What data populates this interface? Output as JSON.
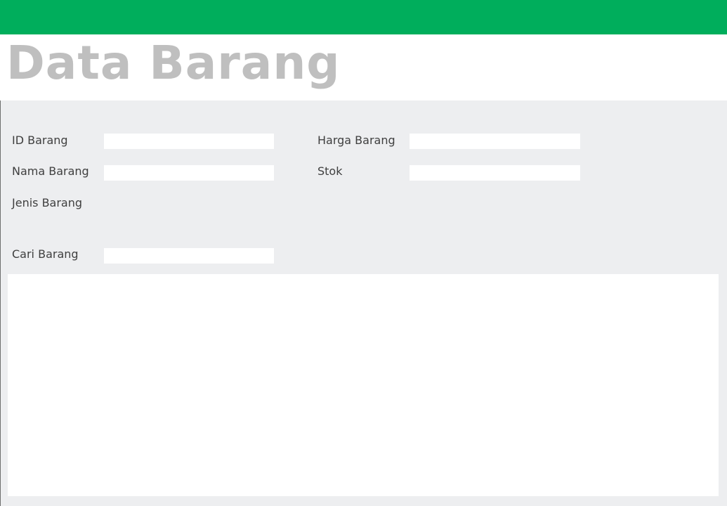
{
  "header": {
    "accent_color": "#00ae5c",
    "title": "Data Barang"
  },
  "form": {
    "id_label": "ID Barang",
    "id_value": "",
    "name_label": "Nama Barang",
    "name_value": "",
    "type_label": "Jenis Barang",
    "price_label": "Harga Barang",
    "price_value": "",
    "stock_label": "Stok",
    "stock_value": ""
  },
  "search": {
    "label": "Cari Barang",
    "value": ""
  },
  "table": {
    "rows": []
  }
}
